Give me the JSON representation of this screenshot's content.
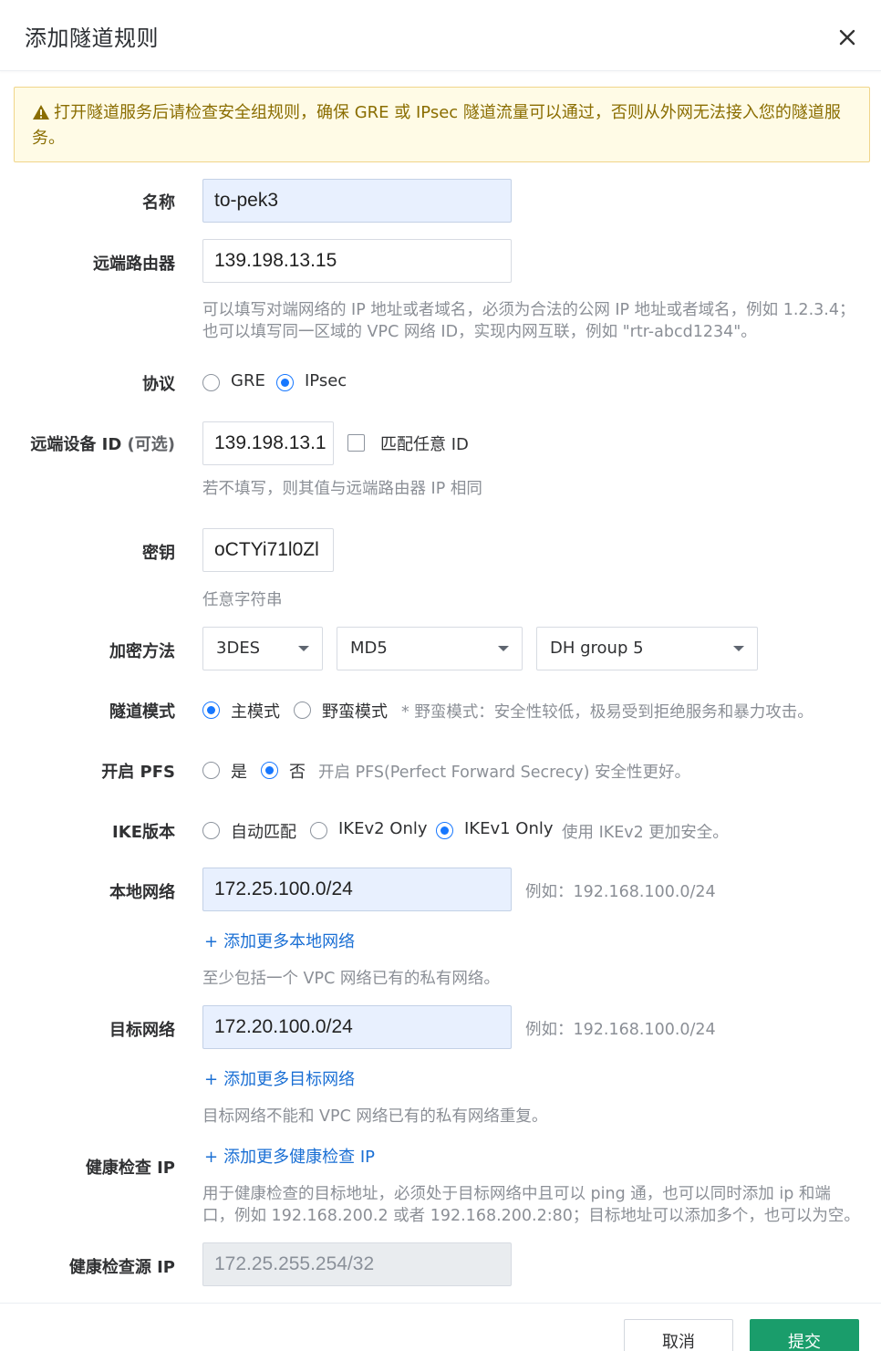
{
  "dialog": {
    "title": "添加隧道规则"
  },
  "alert": {
    "text": "打开隧道服务后请检查安全组规则，确保 GRE 或 IPsec 隧道流量可以通过，否则从外网无法接入您的隧道服务。",
    "line1": "打开隧道服务后请检查安全组规则，确保 GRE 或 IPsec 隧道流量可以通过，否则从外网无法接入您的隧道服",
    "line2": "务。"
  },
  "name": {
    "label": "名称",
    "value": "to-pek3"
  },
  "remote_router": {
    "label": "远端路由器",
    "value": "139.198.13.15",
    "hint_line1": "可以填写对端网络的 IP 地址或者域名，必须为合法的公网 IP 地址或者域名，例如 1.2.3.4；",
    "hint_line2": "也可以填写同一区域的 VPC 网络 ID，实现内网互联，例如 \"rtr-abcd1234\"。"
  },
  "protocol": {
    "label": "协议",
    "options": [
      "GRE",
      "IPsec"
    ],
    "selected": "IPsec"
  },
  "remote_device_id": {
    "label": "远端设备 ID",
    "optional": "(可选)",
    "value": "139.198.13.1",
    "match_any_label": "匹配任意 ID",
    "hint": "若不填写，则其值与远端路由器 IP 相同"
  },
  "secret": {
    "label": "密钥",
    "value": "oCTYi71l0Zl",
    "hint": "任意字符串"
  },
  "encryption": {
    "label": "加密方法",
    "cipher": "3DES",
    "hash": "MD5",
    "dh_group": "DH group 5"
  },
  "tunnel_mode": {
    "label": "隧道模式",
    "options": [
      "主模式",
      "野蛮模式"
    ],
    "selected": "主模式",
    "note": "* 野蛮模式：安全性较低，极易受到拒绝服务和暴力攻击。"
  },
  "pfs": {
    "label": "开启 PFS",
    "options": [
      "是",
      "否"
    ],
    "selected": "否",
    "note": "开启 PFS(Perfect Forward Secrecy) 安全性更好。"
  },
  "ike_version": {
    "label": "IKE版本",
    "options": [
      "自动匹配",
      "IKEv2 Only",
      "IKEv1 Only"
    ],
    "selected": "IKEv1 Only",
    "note": "使用 IKEv2 更加安全。"
  },
  "local_network": {
    "label": "本地网络",
    "value": "172.25.100.0/24",
    "example": "例如：192.168.100.0/24",
    "add_link": "添加更多本地网络",
    "hint": "至少包括一个 VPC 网络已有的私有网络。"
  },
  "target_network": {
    "label": "目标网络",
    "value": "172.20.100.0/24",
    "example": "例如：192.168.100.0/24",
    "add_link": "添加更多目标网络",
    "hint": "目标网络不能和 VPC 网络已有的私有网络重复。"
  },
  "health_check_ip": {
    "label": "健康检查 IP",
    "add_link": "添加更多健康检查 IP",
    "hint_line1": "用于健康检查的目标地址，必须处于目标网络中且可以 ping 通，也可以同时添加 ip 和端",
    "hint_line2": "口，例如 192.168.200.2 或者 192.168.200.2:80；目标地址可以添加多个，也可以为空。"
  },
  "health_check_source_ip": {
    "label": "健康检查源 IP",
    "value": "172.25.255.254/32"
  },
  "footer": {
    "cancel": "取消",
    "submit": "提交"
  },
  "colors": {
    "primary": "#1677ff",
    "submit": "#1a9d6b",
    "link": "#1a6fd4",
    "warning_bg": "#fffbe6",
    "warning_text": "#8a6d00"
  }
}
